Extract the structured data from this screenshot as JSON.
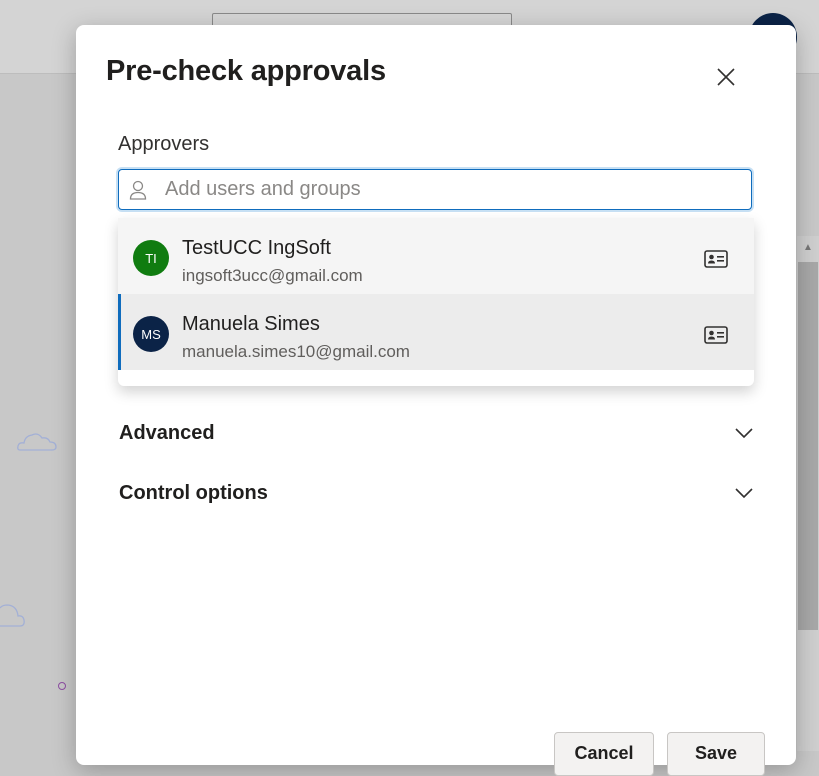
{
  "dialog": {
    "title": "Pre-check approvals",
    "close_icon": "close-icon"
  },
  "approvers": {
    "label": "Approvers",
    "placeholder": "Add users and groups",
    "value": "",
    "icon": "person-icon"
  },
  "suggestions": [
    {
      "initials": "TI",
      "name": "TestUCC IngSoft",
      "email": "ingsoft3ucc@gmail.com",
      "avatar_color": "#107c10",
      "selected": false,
      "icon": "contact-card-icon"
    },
    {
      "initials": "MS",
      "name": "Manuela Simes",
      "email": "manuela.simes10@gmail.com",
      "avatar_color": "#0b2347",
      "selected": true,
      "icon": "contact-card-icon"
    }
  ],
  "sections": [
    {
      "title": "Advanced",
      "icon": "chevron-down-icon"
    },
    {
      "title": "Control options",
      "icon": "chevron-down-icon"
    }
  ],
  "footer": {
    "cancel_label": "Cancel",
    "save_label": "Save"
  },
  "colors": {
    "accent": "#0f6cbd",
    "overlay": "#c8c8c8"
  }
}
